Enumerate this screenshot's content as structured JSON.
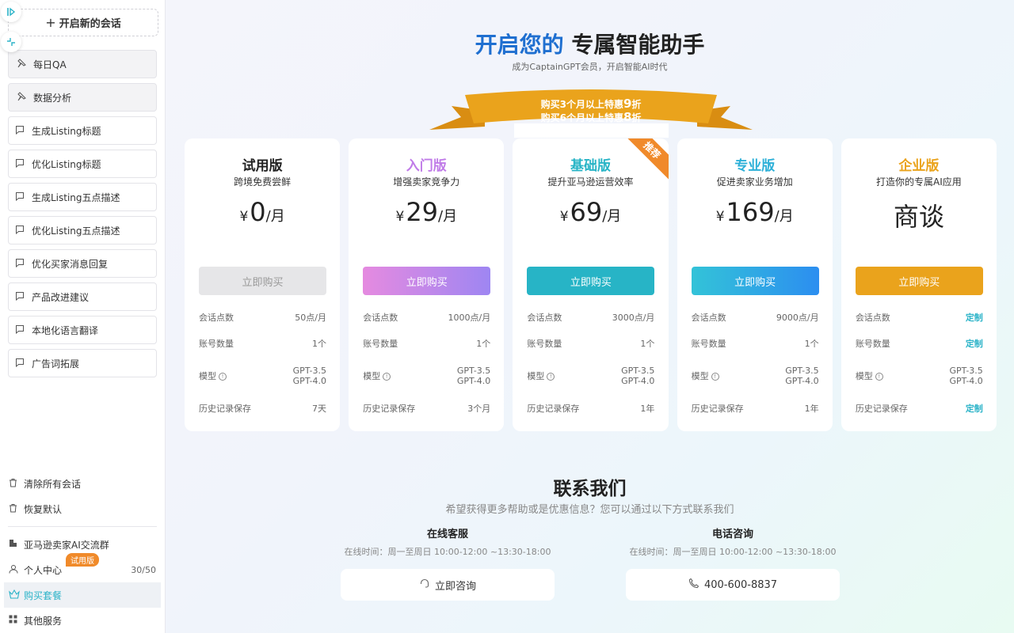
{
  "sidebar": {
    "new_chat": "开启新的会话",
    "pinned": [
      {
        "label": "每日QA"
      },
      {
        "label": "数据分析"
      }
    ],
    "items": [
      {
        "label": "生成Listing标题"
      },
      {
        "label": "优化Listing标题"
      },
      {
        "label": "生成Listing五点描述"
      },
      {
        "label": "优化Listing五点描述"
      },
      {
        "label": "优化买家消息回复"
      },
      {
        "label": "产品改进建议"
      },
      {
        "label": "本地化语言翻译"
      },
      {
        "label": "广告词拓展"
      }
    ],
    "clear_all": "清除所有会话",
    "restore_default": "恢复默认",
    "community": "亚马逊卖家AI交流群",
    "profile": "个人中心",
    "profile_badge": "试用版",
    "profile_count": "30/50",
    "buy_plan": "购买套餐",
    "other_services": "其他服务"
  },
  "hero": {
    "title_blue": "开启您的",
    "title_dark": "专属智能助手",
    "subtitle": "成为CaptainGPT会员，开启智能AI时代"
  },
  "ribbon": {
    "line1_pre": "购买3个月以上特惠",
    "line1_num": "9",
    "line1_post": "折",
    "line2_pre": "购买6个月以上特惠",
    "line2_num": "8",
    "line2_post": "折"
  },
  "plans": [
    {
      "name": "试用版",
      "desc": "跨境免费尝鲜",
      "yen": "¥",
      "price": "0",
      "unit": "/月",
      "button": "立即购买",
      "r1l": "会话点数",
      "r1v": "50点/月",
      "r2l": "账号数量",
      "r2v": "1个",
      "r3l": "模型",
      "r3v1": "GPT-3.5",
      "r3v2": "GPT-4.0",
      "r4l": "历史记录保存",
      "r4v": "7天"
    },
    {
      "name": "入门版",
      "desc": "增强卖家竞争力",
      "yen": "¥",
      "price": "29",
      "unit": "/月",
      "button": "立即购买",
      "r1l": "会话点数",
      "r1v": "1000点/月",
      "r2l": "账号数量",
      "r2v": "1个",
      "r3l": "模型",
      "r3v1": "GPT-3.5",
      "r3v2": "GPT-4.0",
      "r4l": "历史记录保存",
      "r4v": "3个月"
    },
    {
      "name": "基础版",
      "desc": "提升亚马逊运营效率",
      "yen": "¥",
      "price": "69",
      "unit": "/月",
      "button": "立即购买",
      "badge": "推荐",
      "r1l": "会话点数",
      "r1v": "3000点/月",
      "r2l": "账号数量",
      "r2v": "1个",
      "r3l": "模型",
      "r3v1": "GPT-3.5",
      "r3v2": "GPT-4.0",
      "r4l": "历史记录保存",
      "r4v": "1年"
    },
    {
      "name": "专业版",
      "desc": "促进卖家业务增加",
      "yen": "¥",
      "price": "169",
      "unit": "/月",
      "button": "立即购买",
      "r1l": "会话点数",
      "r1v": "9000点/月",
      "r2l": "账号数量",
      "r2v": "1个",
      "r3l": "模型",
      "r3v1": "GPT-3.5",
      "r3v2": "GPT-4.0",
      "r4l": "历史记录保存",
      "r4v": "1年"
    },
    {
      "name": "企业版",
      "desc": "打造你的专属AI应用",
      "price_text": "商谈",
      "button": "立即购买",
      "r1l": "会话点数",
      "r1v": "定制",
      "r2l": "账号数量",
      "r2v": "定制",
      "r3l": "模型",
      "r3v1": "GPT-3.5",
      "r3v2": "GPT-4.0",
      "r4l": "历史记录保存",
      "r4v": "定制"
    }
  ],
  "contact": {
    "title": "联系我们",
    "subtitle": "希望获得更多帮助或是优惠信息？您可以通过以下方式联系我们",
    "online": {
      "title": "在线客服",
      "hours": "在线时间：周一至周日 10:00-12:00 ~13:30-18:00",
      "button": "立即咨询"
    },
    "phone": {
      "title": "电话咨询",
      "hours": "在线时间：周一至周日 10:00-12:00 ~13:30-18:00",
      "button": "400-600-8837"
    }
  },
  "colors": {
    "accent": "#2bb3c8",
    "brand_blue": "#1f6fd0",
    "ribbon": "#eaa31c",
    "plan_trial_btn": "#e6e6e8",
    "plan_starter_name": "#c07be8",
    "plan_basic": "#27b4c6",
    "plan_pro": "#2db0d8",
    "plan_enterprise": "#eaa31c"
  }
}
